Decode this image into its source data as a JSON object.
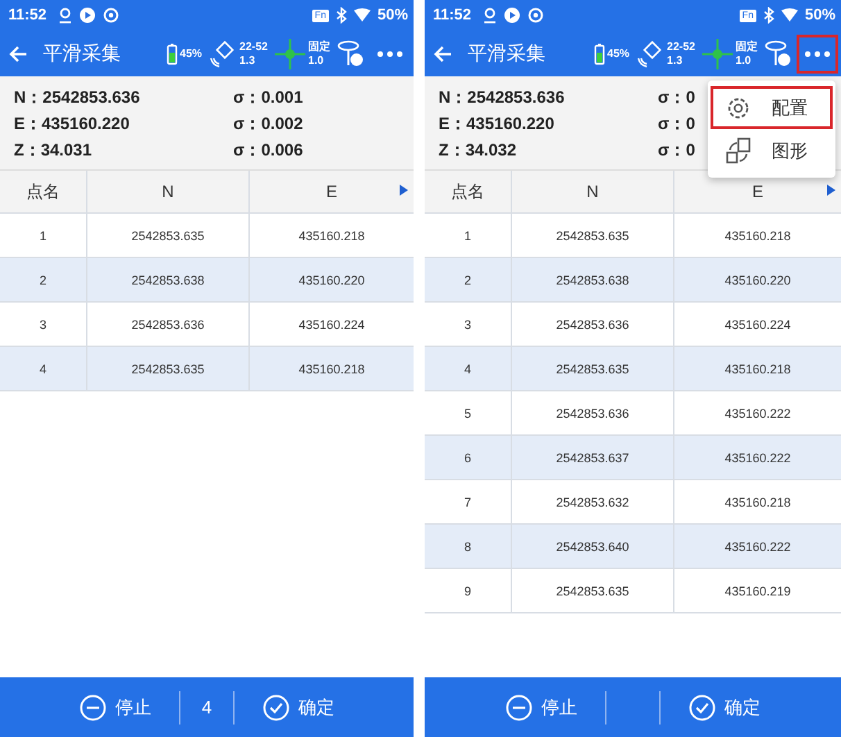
{
  "screens": [
    {
      "status_bar": {
        "time": "11:52",
        "fn": "Fn",
        "battery": "50%"
      },
      "title_bar": {
        "title": "平滑采集",
        "battery": "45%",
        "satellites": "22-52",
        "pdop": "1.3",
        "solution": "固定",
        "age": "1.0",
        "more_highlighted": false
      },
      "coordinates": [
        {
          "value": "N：2542853.636",
          "sigma": "σ：0.001"
        },
        {
          "value": "E：435160.220",
          "sigma": "σ：0.002"
        },
        {
          "value": "Z：34.031",
          "sigma": "σ：0.006"
        }
      ],
      "table": {
        "columns": [
          "点名",
          "N",
          "E"
        ],
        "rows": [
          [
            "1",
            "2542853.635",
            "435160.218"
          ],
          [
            "2",
            "2542853.638",
            "435160.220"
          ],
          [
            "3",
            "2542853.636",
            "435160.224"
          ],
          [
            "4",
            "2542853.635",
            "435160.218"
          ]
        ]
      },
      "footer": {
        "stop": "停止",
        "count": "4",
        "confirm": "确定"
      }
    },
    {
      "status_bar": {
        "time": "11:52",
        "fn": "Fn",
        "battery": "50%"
      },
      "title_bar": {
        "title": "平滑采集",
        "battery": "45%",
        "satellites": "22-52",
        "pdop": "1.3",
        "solution": "固定",
        "age": "1.0",
        "more_highlighted": true
      },
      "coordinates": [
        {
          "value": "N：2542853.636",
          "sigma": "σ：0"
        },
        {
          "value": "E：435160.220",
          "sigma": "σ：0"
        },
        {
          "value": "Z：34.032",
          "sigma": "σ：0"
        }
      ],
      "table": {
        "columns": [
          "点名",
          "N",
          "E"
        ],
        "rows": [
          [
            "1",
            "2542853.635",
            "435160.218"
          ],
          [
            "2",
            "2542853.638",
            "435160.220"
          ],
          [
            "3",
            "2542853.636",
            "435160.224"
          ],
          [
            "4",
            "2542853.635",
            "435160.218"
          ],
          [
            "5",
            "2542853.636",
            "435160.222"
          ],
          [
            "6",
            "2542853.637",
            "435160.222"
          ],
          [
            "7",
            "2542853.632",
            "435160.218"
          ],
          [
            "8",
            "2542853.640",
            "435160.222"
          ],
          [
            "9",
            "2542853.635",
            "435160.219"
          ]
        ]
      },
      "menu": {
        "items": [
          {
            "kind": "settings",
            "label": "配置",
            "selected": true
          },
          {
            "kind": "graphic",
            "label": "图形",
            "selected": false
          }
        ]
      },
      "footer": {
        "stop": "停止",
        "confirm": "确定"
      }
    }
  ]
}
